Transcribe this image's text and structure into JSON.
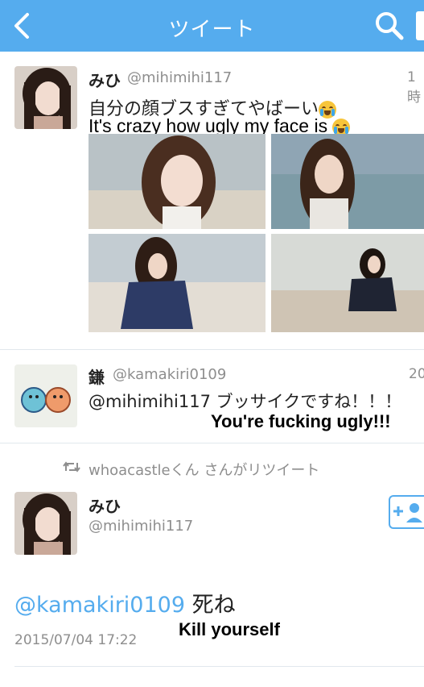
{
  "header": {
    "title": "ツイート"
  },
  "tweet1": {
    "name": "みひ",
    "handle": "@mihimihi117",
    "time": "1時",
    "text_jp": "自分の顔ブスすぎてやばーい",
    "overlay_en": "It's crazy how ugly my face is"
  },
  "reply": {
    "name": "鎌",
    "handle": "@kamakiri0109",
    "time": "20",
    "text": "@mihimihi117 ブッサイクですね！！！",
    "overlay_en": "You're fucking ugly!!!"
  },
  "retweet": {
    "label": "whoacastleくん さんがリツイート"
  },
  "tweet2": {
    "name": "みひ",
    "handle": "@mihimihi117",
    "mention": "@kamakiri0109",
    "text": " 死ね",
    "timestamp": "2015/07/04 17:22",
    "overlay_en": "Kill yourself"
  },
  "colors": {
    "header_blue": "#55acee",
    "link_blue": "#55acee",
    "gray_text": "#8e8e8e"
  }
}
